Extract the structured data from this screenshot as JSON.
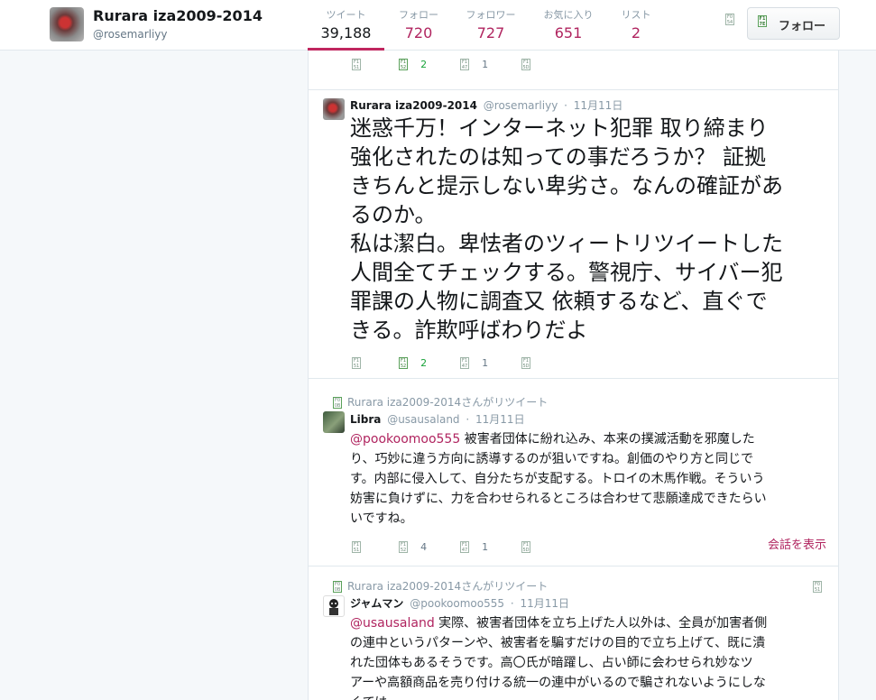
{
  "profile": {
    "name": "Rurara iza2009-2014",
    "handle": "@rosemarliyy"
  },
  "stats": [
    {
      "label": "ツイート",
      "value": "39,188"
    },
    {
      "label": "フォロー",
      "value": "720"
    },
    {
      "label": "フォロワー",
      "value": "727"
    },
    {
      "label": "お気に入り",
      "value": "651"
    },
    {
      "label": "リスト",
      "value": "2"
    }
  ],
  "follow_button": {
    "label": "フォロー"
  },
  "tweet0": {
    "retweet_count": "2",
    "favorite_count": "1"
  },
  "tweet1": {
    "author": "Rurara iza2009-2014",
    "handle": "@rosemarliyy",
    "date": "11月11日",
    "lines": [
      "迷惑千万！インターネット犯罪 取り締まり",
      "強化されたのは知っての事だろうか？  証拠",
      "きちんと提示しない卑劣さ。なんの確証があ",
      "るのか。",
      "私は潔白。卑怯者のツィートリツイートした",
      "人間全てチェックする。警視庁、サイバー犯",
      "罪課の人物に調査又 依頼するなど、直ぐで",
      "きる。詐欺呼ばわりだよ"
    ],
    "retweet_count": "2",
    "favorite_count": "1"
  },
  "tweet2": {
    "retweeted_by": "Rurara iza2009-2014さんがリツイート",
    "author": "Libra",
    "handle": "@usausaland",
    "date": "11月11日",
    "mention": "@pookoomoo555",
    "line1_rest": " 被害者団体に紛れ込み、本来の撲滅活動を邪魔した",
    "lines": [
      "り、巧妙に違う方向に誘導するのが狙いですね。創価のやり方と同じで",
      "す。内部に侵入して、自分たちが支配する。トロイの木馬作戦。そういう",
      "妨害に負けずに、力を合わせられるところは合わせて悲願達成できたらい",
      "いですね。"
    ],
    "retweet_count": "4",
    "favorite_count": "1",
    "show_conversation": "会話を表示"
  },
  "tweet3": {
    "retweeted_by": "Rurara iza2009-2014さんがリツイート",
    "author": "ジャムマン",
    "handle": "@pookoomoo555",
    "date": "11月11日",
    "mention": "@usausaland",
    "line1_rest": " 実際、被害者団体を立ち上げた人以外は、全員が加害者側",
    "lines": [
      "の連中というパターンや、被害者を騙すだけの目的で立ち上げて、既に潰",
      "れた団体もあるそうです。高〇氏が暗躍し、占い師に会わせられ妙なツ",
      "アーや高額商品を売り付ける統一の連中がいるので騙されないようにしな",
      "くては"
    ]
  },
  "icons": [
    "reply-icon",
    "retweet-icon",
    "favorite-icon",
    "more-icon",
    "retweet-label-icon",
    "user-dropdown-icon"
  ]
}
